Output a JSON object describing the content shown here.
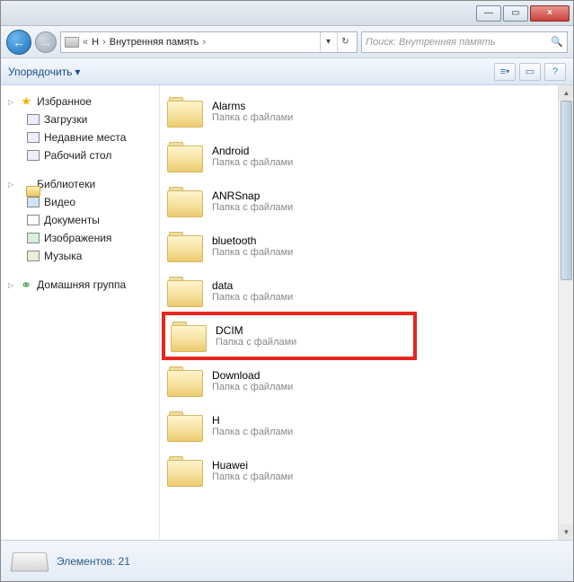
{
  "window": {
    "minimize": "—",
    "maximize": "▭",
    "close": "×"
  },
  "breadcrumb": {
    "caret": "«",
    "seg1": "Н",
    "seg2": "Внутренняя память",
    "chev": "›",
    "dropdown": "▾",
    "refresh": "↻"
  },
  "search": {
    "placeholder": "Поиск: Внутренняя память",
    "icon": "🔍"
  },
  "toolbar": {
    "organize": "Упорядочить",
    "chev": "▾",
    "view": "≡",
    "preview": "▭",
    "help": "?"
  },
  "sidebar": {
    "favorites": {
      "label": "Избранное",
      "items": [
        {
          "label": "Загрузки",
          "cls": "down"
        },
        {
          "label": "Недавние места",
          "cls": "recent"
        },
        {
          "label": "Рабочий стол",
          "cls": "desk"
        }
      ]
    },
    "libraries": {
      "label": "Библиотеки",
      "items": [
        {
          "label": "Видео",
          "cls": "vid"
        },
        {
          "label": "Документы",
          "cls": "doc"
        },
        {
          "label": "Изображения",
          "cls": "img"
        },
        {
          "label": "Музыка",
          "cls": "mus"
        }
      ]
    },
    "homegroup": {
      "label": "Домашняя группа"
    }
  },
  "folders": {
    "subtitle": "Папка с файлами",
    "items": [
      {
        "name": "Alarms",
        "hl": false
      },
      {
        "name": "Android",
        "hl": false
      },
      {
        "name": "ANRSnap",
        "hl": false
      },
      {
        "name": "bluetooth",
        "hl": false
      },
      {
        "name": "data",
        "hl": false
      },
      {
        "name": "DCIM",
        "hl": true
      },
      {
        "name": "Download",
        "hl": false
      },
      {
        "name": "H",
        "hl": false
      },
      {
        "name": "Huawei",
        "hl": false
      }
    ]
  },
  "status": {
    "text": "Элементов: 21"
  }
}
